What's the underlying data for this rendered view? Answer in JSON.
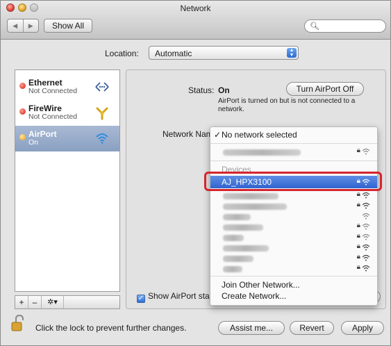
{
  "window": {
    "title": "Network"
  },
  "toolbar": {
    "back": "◀",
    "forward": "▶",
    "show_all": "Show All",
    "search_placeholder": ""
  },
  "location": {
    "label": "Location:",
    "value": "Automatic"
  },
  "sidebar": {
    "items": [
      {
        "name": "Ethernet",
        "status": "Not Connected",
        "icon": "ethernet-icon",
        "dot": "red"
      },
      {
        "name": "FireWire",
        "status": "Not Connected",
        "icon": "firewire-icon",
        "dot": "red"
      },
      {
        "name": "AirPort",
        "status": "On",
        "icon": "wifi-icon",
        "dot": "orange",
        "selected": true
      }
    ],
    "tools": {
      "add": "+",
      "remove": "–",
      "gear": "✲▾"
    }
  },
  "detail": {
    "status_label": "Status:",
    "status_value": "On",
    "turn_off_button": "Turn AirPort Off",
    "status_note": "AirPort is turned on but is not connected to a network.",
    "network_name_label": "Network Name"
  },
  "network_menu": {
    "selected_label": "No network selected",
    "devices_header": "Devices",
    "highlighted_network": "AJ_HPX3100",
    "join_other": "Join Other Network...",
    "create_network": "Create Network..."
  },
  "show_airport": {
    "label": "Show AirPort sta",
    "checked": true
  },
  "help_label": "?",
  "footer": {
    "lock_text": "Click the lock to prevent further changes.",
    "assist_button": "Assist me...",
    "revert_button": "Revert",
    "apply_button": "Apply"
  },
  "colors": {
    "accent": "#2f63cf",
    "highlight_box": "#d4252d"
  }
}
